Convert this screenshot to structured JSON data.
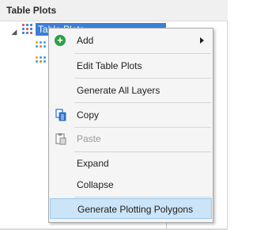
{
  "panel": {
    "title": "Table Plots"
  },
  "tree": {
    "expander_icon": "collapse-triangle-icon",
    "root_label": "Table Plots",
    "root_icon": "table-plot-grid-icon",
    "children": [
      {
        "icon": "scatter-dots-icon"
      },
      {
        "icon": "scatter-dots-icon"
      }
    ]
  },
  "context_menu": {
    "items": [
      {
        "label": "Add",
        "icon": "add-icon",
        "submenu": true
      },
      {
        "label": "Edit Table Plots"
      },
      {
        "label": "Generate All Layers"
      },
      {
        "label": "Copy",
        "icon": "copy-icon"
      },
      {
        "label": "Paste",
        "icon": "paste-icon",
        "disabled": true
      },
      {
        "label": "Expand"
      },
      {
        "label": "Collapse"
      },
      {
        "label": "Generate Plotting Polygons",
        "highlighted": true
      }
    ]
  },
  "colors": {
    "selection": "#3c7fd6",
    "hover": "#cce4f7",
    "add_icon": "#2f9f4a"
  }
}
